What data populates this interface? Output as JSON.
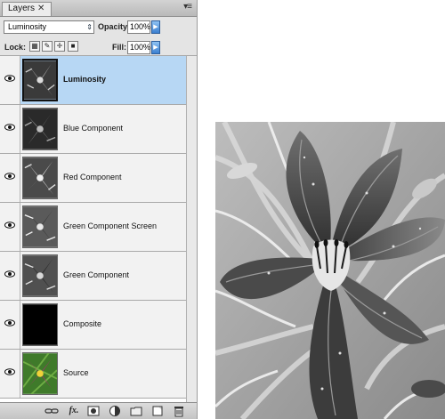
{
  "panel": {
    "tab_label": "Layers",
    "close_glyph": "✕",
    "menu_glyph": "▾≡",
    "blend_mode": "Luminosity",
    "opacity_label": "Opacity:",
    "opacity_value": "100%",
    "lock_label": "Lock:",
    "fill_label": "Fill:",
    "fill_value": "100%"
  },
  "layers": [
    {
      "name": "Luminosity",
      "selected": true,
      "visible": true
    },
    {
      "name": "Blue Component",
      "selected": false,
      "visible": true
    },
    {
      "name": "Red Component",
      "selected": false,
      "visible": true
    },
    {
      "name": "Green Component Screen",
      "selected": false,
      "visible": true
    },
    {
      "name": "Green Component",
      "selected": false,
      "visible": true
    },
    {
      "name": "Composite",
      "selected": false,
      "visible": true
    },
    {
      "name": "Source",
      "selected": false,
      "visible": true
    }
  ],
  "bottom_icons": [
    "link-layers-icon",
    "fx-icon",
    "add-mask-icon",
    "adjustment-layer-icon",
    "new-group-icon",
    "new-layer-icon",
    "trash-icon"
  ],
  "bottom_glyphs": {
    "fx": "fx."
  },
  "colors": {
    "selected_row": "#b7d7f4",
    "accent_button": "#3a7fd0"
  }
}
